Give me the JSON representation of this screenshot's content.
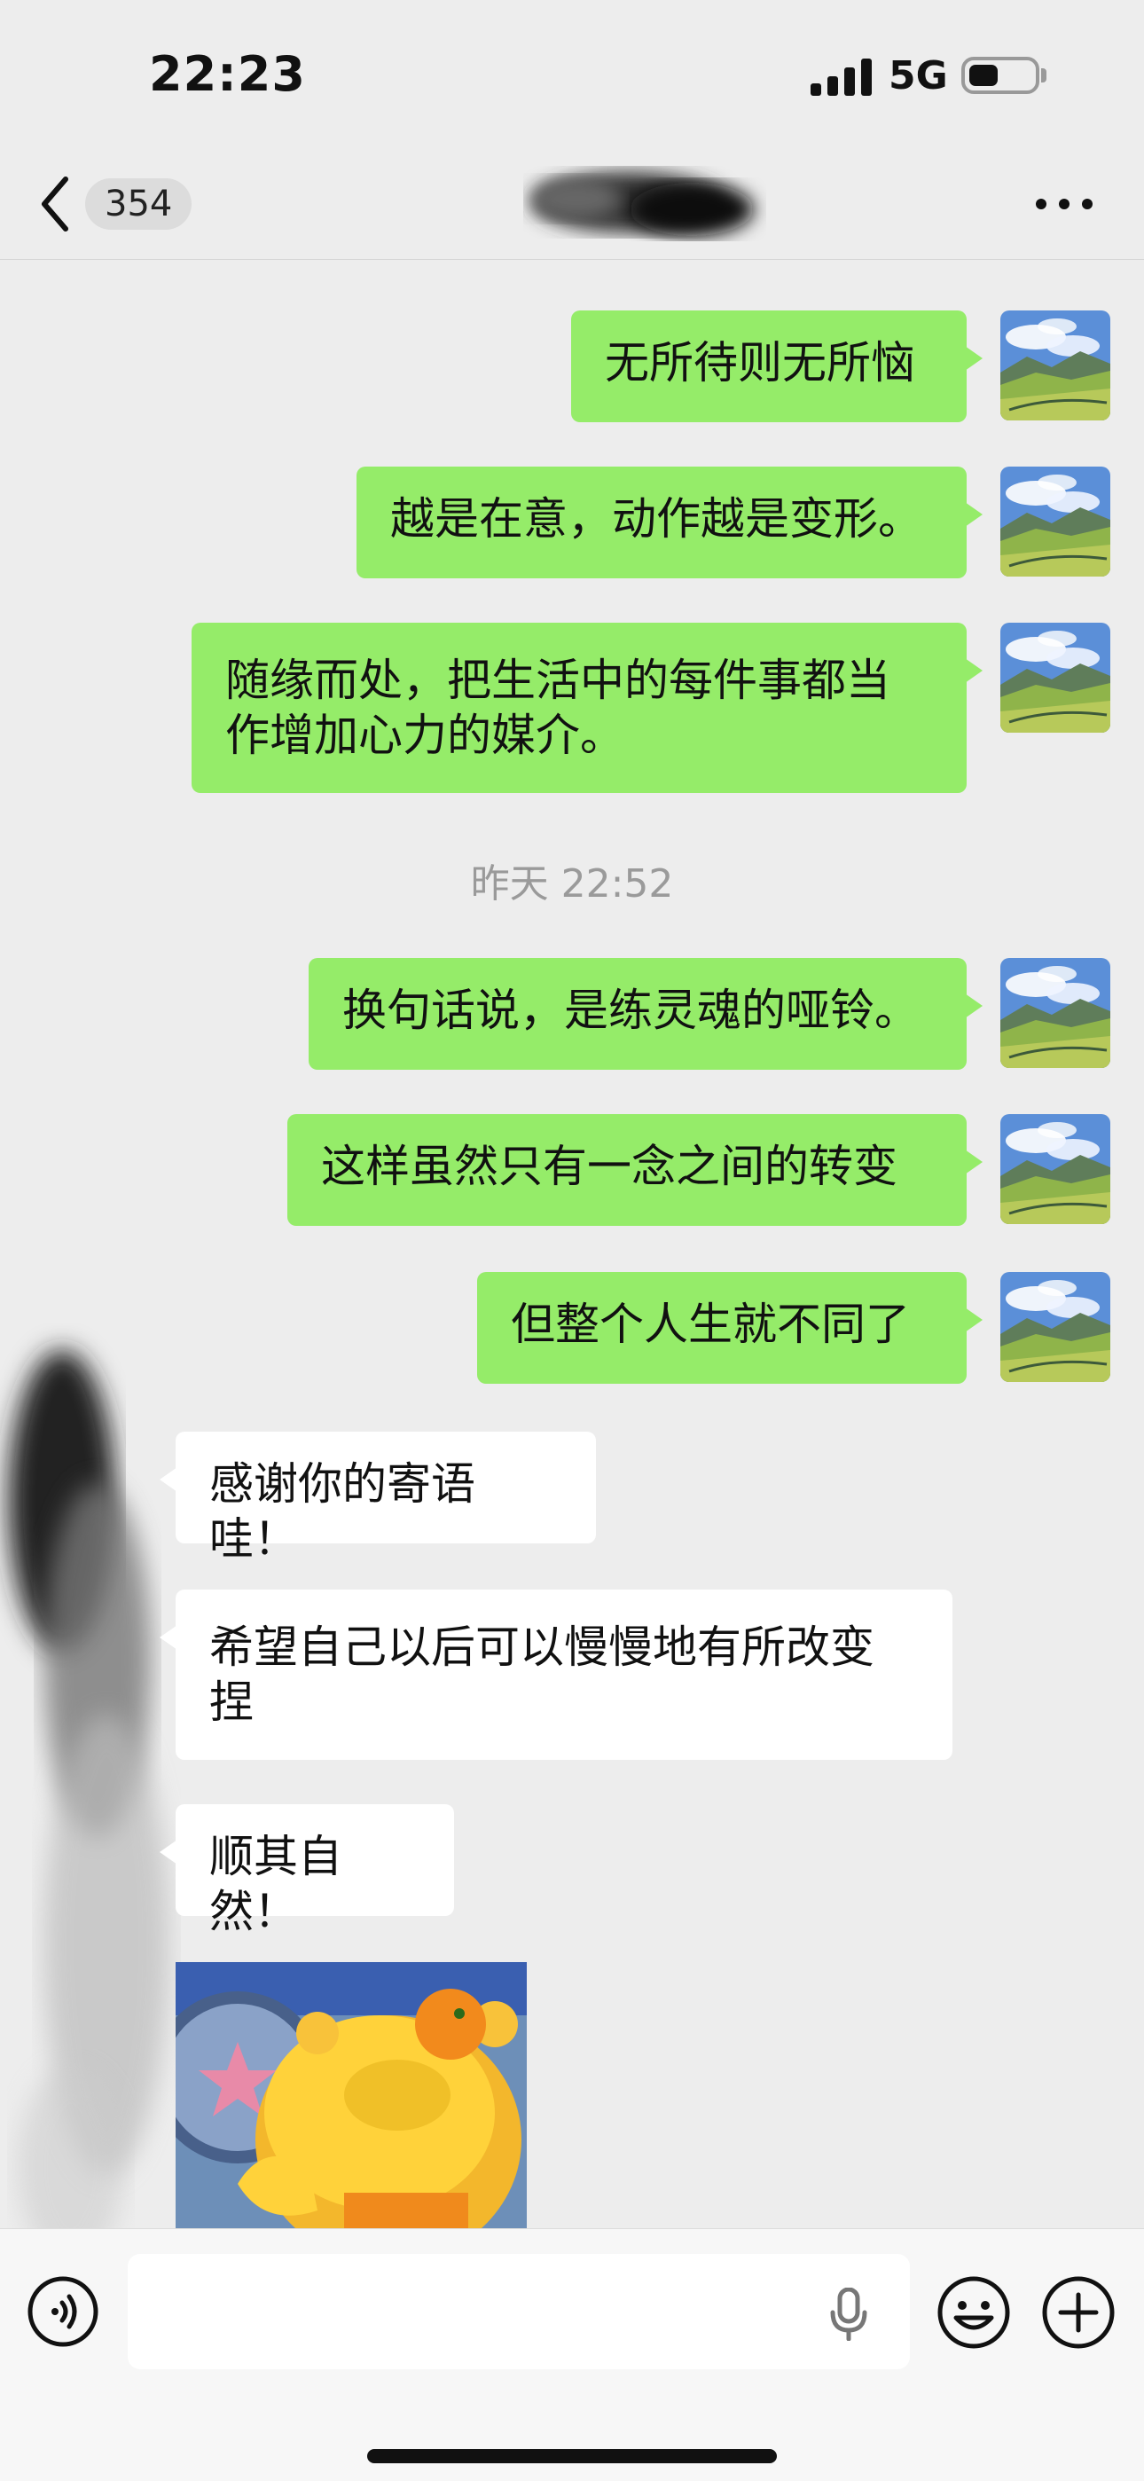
{
  "status_bar": {
    "time": "22:23",
    "network": "5G",
    "battery_level": 0.45
  },
  "nav": {
    "unread_count": "354"
  },
  "colors": {
    "outgoing_bubble": "#95ec69",
    "incoming_bubble": "#ffffff",
    "background": "#ededed"
  },
  "messages": {
    "m1": "无所待则无所恼",
    "m2": "越是在意，动作越是变形。",
    "m3_line1": "随缘而处，把生活中的每件事都当",
    "m3_line2": "作增加心力的媒介。",
    "divider": "昨天 22:52",
    "m4": "换句话说，是练灵魂的哑铃。",
    "m5": "这样虽然只有一念之间的转变",
    "m6": "但整个人生就不同了",
    "r1": "感谢你的寄语哇！",
    "r2_line1": "希望自己以后可以慢慢地有所改变",
    "r2_line2": "捏",
    "r3": "顺其自然！"
  },
  "icons": {
    "back": "chevron-left-icon",
    "more": "more-dots-icon",
    "voice": "voice-input-icon",
    "mic": "microphone-icon",
    "emoji": "emoji-icon",
    "add": "plus-icon"
  }
}
